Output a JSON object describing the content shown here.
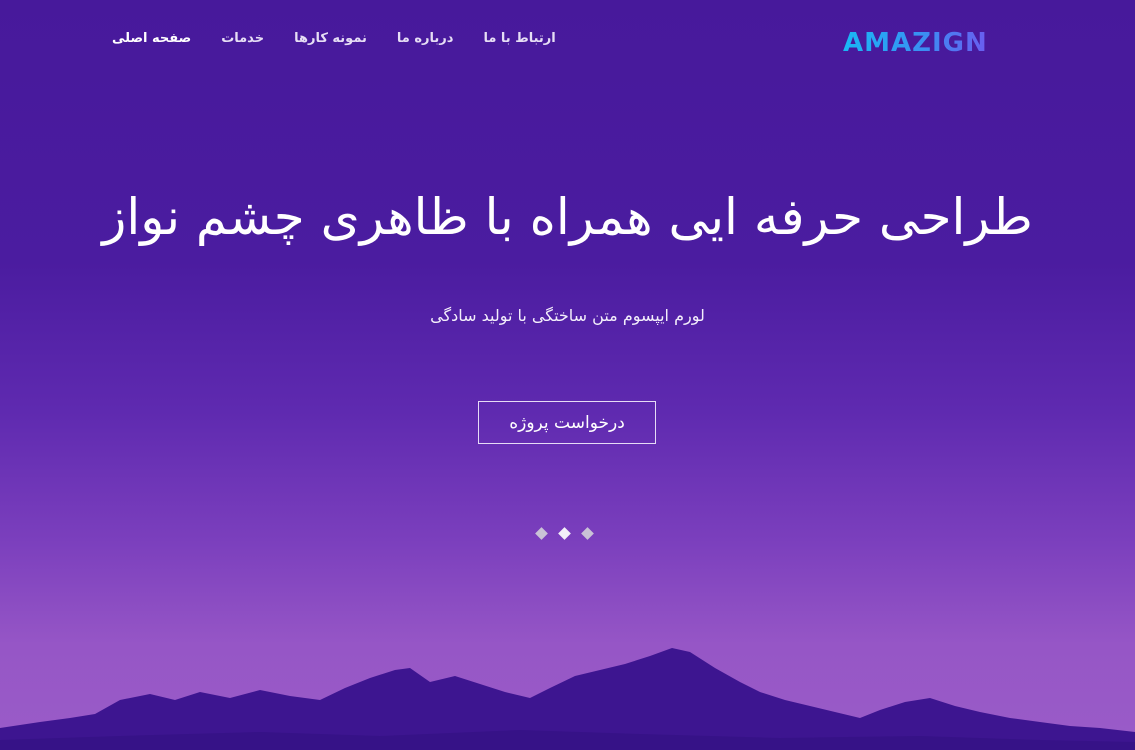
{
  "brand": {
    "logo_text": "AMAZIGN",
    "colors": {
      "from": "#19b8f5",
      "to": "#6b5cf0"
    }
  },
  "nav": {
    "items": [
      {
        "label": "صفحه اصلی",
        "active": true
      },
      {
        "label": "خدمات"
      },
      {
        "label": "نمونه کارها"
      },
      {
        "label": "درباره ما"
      },
      {
        "label": "ارتباط با ما"
      }
    ]
  },
  "hero": {
    "title": "طراحی حرفه ایی همراه با ظاهری چشم نواز",
    "subtitle": "لورم ایپسوم متن ساختگی با تولید سادگی",
    "cta_label": "درخواست پروژه",
    "background_colors": [
      "#47199b",
      "#9a5cc8"
    ],
    "mountain_color": "#3d1590"
  },
  "slider": {
    "dot_count": 3,
    "active_index": 1
  }
}
